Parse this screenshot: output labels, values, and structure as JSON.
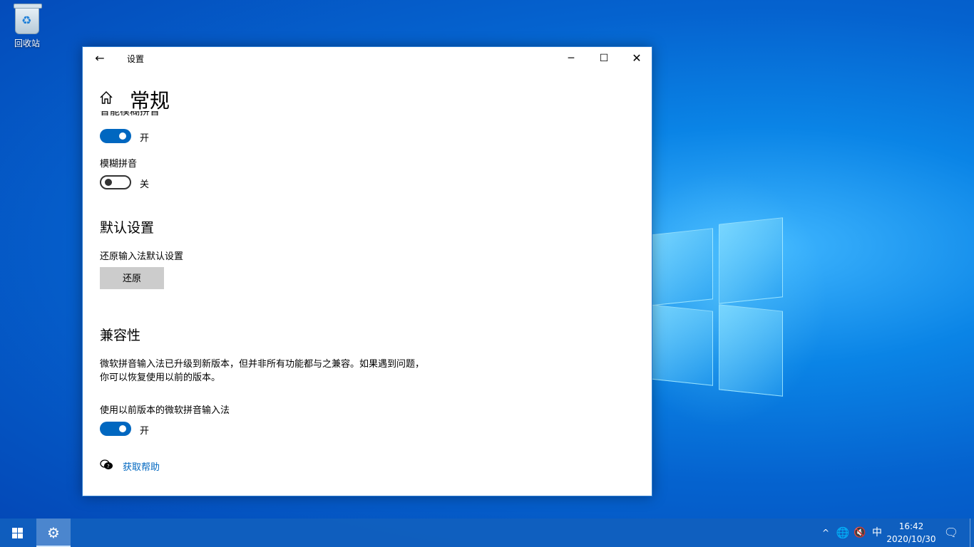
{
  "desktop": {
    "icons": [
      {
        "label": "回收站",
        "icon": "recycle-bin-icon"
      }
    ]
  },
  "window": {
    "title": "设置",
    "back_icon": "←",
    "min_icon": "─",
    "max_icon": "☐",
    "close_icon": "✕",
    "page_title": "常规",
    "home_icon": "home-icon"
  },
  "settings": {
    "cut_off_label": "智能模糊拼音",
    "smart_fuzzy": {
      "state": "开",
      "on": true
    },
    "fuzzy": {
      "label": "模糊拼音",
      "state": "关",
      "on": false
    },
    "defaults_section": "默认设置",
    "restore_label": "还原输入法默认设置",
    "restore_button": "还原",
    "compat_section": "兼容性",
    "compat_desc": "微软拼音输入法已升级到新版本，但并非所有功能都与之兼容。如果遇到问题，你可以恢复使用以前的版本。",
    "legacy": {
      "label": "使用以前版本的微软拼音输入法",
      "state": "开",
      "on": true
    },
    "help_link": "获取帮助"
  },
  "taskbar": {
    "start_icon": "windows-logo-icon",
    "pinned": [
      {
        "name": "settings",
        "icon": "⚙"
      }
    ],
    "tray": {
      "chevron": "^",
      "network": "🌐",
      "volume": "🔇",
      "ime": "中",
      "time": "16:42",
      "date": "2020/10/30",
      "notifications": "🗨"
    }
  }
}
